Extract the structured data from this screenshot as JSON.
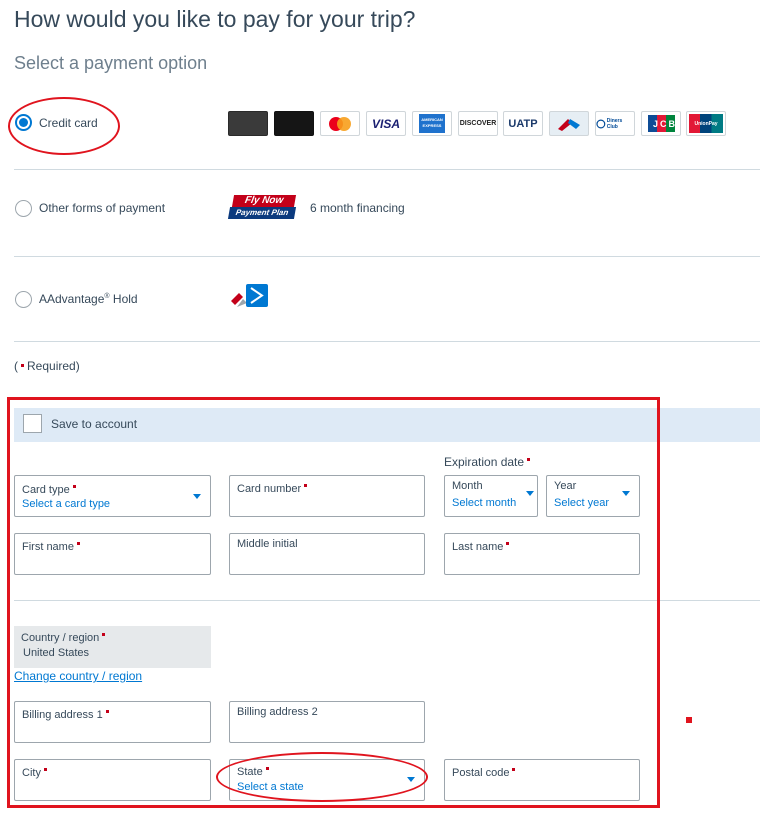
{
  "header": {
    "title": "How would you like to pay for your trip?",
    "subtitle": "Select a payment option"
  },
  "payment_options": {
    "credit_card": {
      "label": "Credit card",
      "selected": true
    },
    "other": {
      "label": "Other forms of payment",
      "financing_logo": "Fly Now Payment Plan",
      "financing_logo_line1": "Fly Now",
      "financing_logo_line2": "Payment Plan",
      "financing_text": "6 month financing"
    },
    "aadvantage": {
      "label": "AAdvantage",
      "sup": "®",
      "label_suffix": "Hold"
    }
  },
  "card_logos": {
    "black1": "",
    "black2": "",
    "mastercard": "",
    "visa": "VISA",
    "amex": "AMERICAN EXPRESS",
    "discover": "DISCOVER",
    "uatp": "UATP",
    "aa": "",
    "diners": "Diners Club",
    "jcb": "JCB",
    "unionpay": "UnionPay"
  },
  "required_note": {
    "open": "(",
    "text": "Required)"
  },
  "form": {
    "save_to_account": "Save to account",
    "expiration_label": "Expiration date",
    "card_type": {
      "label": "Card type",
      "value": "Select a card type"
    },
    "card_number": {
      "label": "Card number"
    },
    "month": {
      "label": "Month",
      "value": "Select month"
    },
    "year": {
      "label": "Year",
      "value": "Select year"
    },
    "first_name": {
      "label": "First name"
    },
    "middle_initial": {
      "label": "Middle initial"
    },
    "last_name": {
      "label": "Last name"
    },
    "country": {
      "label": "Country / region",
      "value": "United States"
    },
    "change_country": "Change country / region",
    "billing_address_1": {
      "label": "Billing address 1"
    },
    "billing_address_2": {
      "label": "Billing address 2"
    },
    "city": {
      "label": "City"
    },
    "state": {
      "label": "State",
      "value": "Select a state"
    },
    "postal_code": {
      "label": "Postal code"
    }
  },
  "colors": {
    "accent": "#0078d2",
    "text": "#36495a",
    "required": "#c30019",
    "annotation": "#e0141e",
    "save_bar": "#deeaf6"
  }
}
